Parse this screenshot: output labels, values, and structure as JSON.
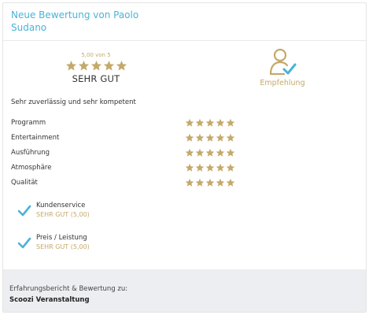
{
  "review": {
    "title": "Neue Bewertung von Paolo Sudano",
    "score_text": "5,00 von 5",
    "verdict": "SEHR GUT",
    "recommendation_label": "Empfehlung",
    "comment": "Sehr zuverlässig und sehr kompetent",
    "star_color": "#c4a96b",
    "accent_color": "#4ab3d8"
  },
  "criteria": [
    {
      "label": "Programm",
      "stars": 5
    },
    {
      "label": "Entertainment",
      "stars": 5
    },
    {
      "label": "Ausführung",
      "stars": 5
    },
    {
      "label": "Atmosphäre",
      "stars": 5
    },
    {
      "label": "Qualität",
      "stars": 5
    }
  ],
  "extras": [
    {
      "label": "Kundenservice",
      "rating": "SEHR GUT (5,00)",
      "icon": "check-icon"
    },
    {
      "label": "Preis / Leistung",
      "rating": "SEHR GUT (5,00)",
      "icon": "check-icon"
    }
  ],
  "footer": {
    "label": "Erfahrungsbericht & Bewertung zu:",
    "subject": "Scoozi Veranstaltung"
  }
}
